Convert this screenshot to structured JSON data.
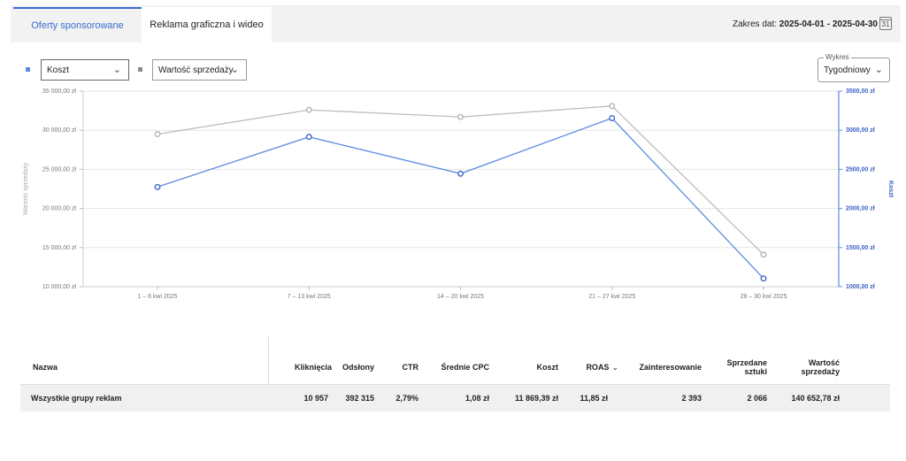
{
  "tabs": [
    {
      "label": "Oferty sponsorowane",
      "active": true
    },
    {
      "label": "Reklama graficzna i wideo",
      "active": false
    }
  ],
  "date_range": {
    "label": "Zakres dat:",
    "value": "2025-04-01 - 2025-04-30",
    "calendar_day": "31"
  },
  "controls": {
    "metric_left": "Koszt",
    "metric_right": "Wartość sprzedaży",
    "wykres_label": "Wykres",
    "wykres_value": "Tygodniowy"
  },
  "colors": {
    "koszt": "#5b8de0",
    "wartosc": "#bdbdbd",
    "accent": "#3a6ecf"
  },
  "chart_data": {
    "type": "line",
    "categories": [
      "1 – 6 kwi 2025",
      "7 – 13 kwi 2025",
      "14 – 20 kwi 2025",
      "21 – 27 kwi 2025",
      "28 – 30 kwi 2025"
    ],
    "series": [
      {
        "name": "Koszt",
        "axis": "right",
        "values": [
          2275,
          2915,
          2445,
          3155,
          1105
        ]
      },
      {
        "name": "Wartość sprzedaży",
        "axis": "left",
        "values": [
          29500,
          32600,
          31700,
          33100,
          14100
        ]
      }
    ],
    "ylabel_left": "Wartość sprzedaży",
    "ylabel_right": "Koszt",
    "ylim_left": [
      10000,
      35000
    ],
    "ylim_right": [
      1000,
      3500
    ],
    "yticks_left": [
      "10 000,00 zł",
      "15 000,00 zł",
      "20 000,00 zł",
      "25 000,00 zł",
      "30 000,00 zł",
      "35 000,00 zł"
    ],
    "yticks_right": [
      "1000,00 zł",
      "1500,00 zł",
      "2000,00 zł",
      "2500,00 zł",
      "3000,00 zł",
      "3500,00 zł"
    ],
    "grid": true
  },
  "table": {
    "headers": {
      "nazwa": "Nazwa",
      "klikniecia": "Kliknięcia",
      "odslony": "Odsłony",
      "ctr": "CTR",
      "cpc": "Średnie CPC",
      "koszt": "Koszt",
      "roas": "ROAS",
      "zainteresowanie": "Zainteresowanie",
      "sprzedane_1": "Sprzedane",
      "sprzedane_2": "sztuki",
      "wartosc_1": "Wartość",
      "wartosc_2": "sprzedaży"
    },
    "row": {
      "nazwa": "Wszystkie grupy reklam",
      "klikniecia": "10 957",
      "odslony": "392 315",
      "ctr": "2,79%",
      "cpc": "1,08 zł",
      "koszt": "11 869,39 zł",
      "roas": "11,85 zł",
      "zainteresowanie": "2 393",
      "sprzedane": "2 066",
      "wartosc": "140 652,78 zł"
    }
  }
}
